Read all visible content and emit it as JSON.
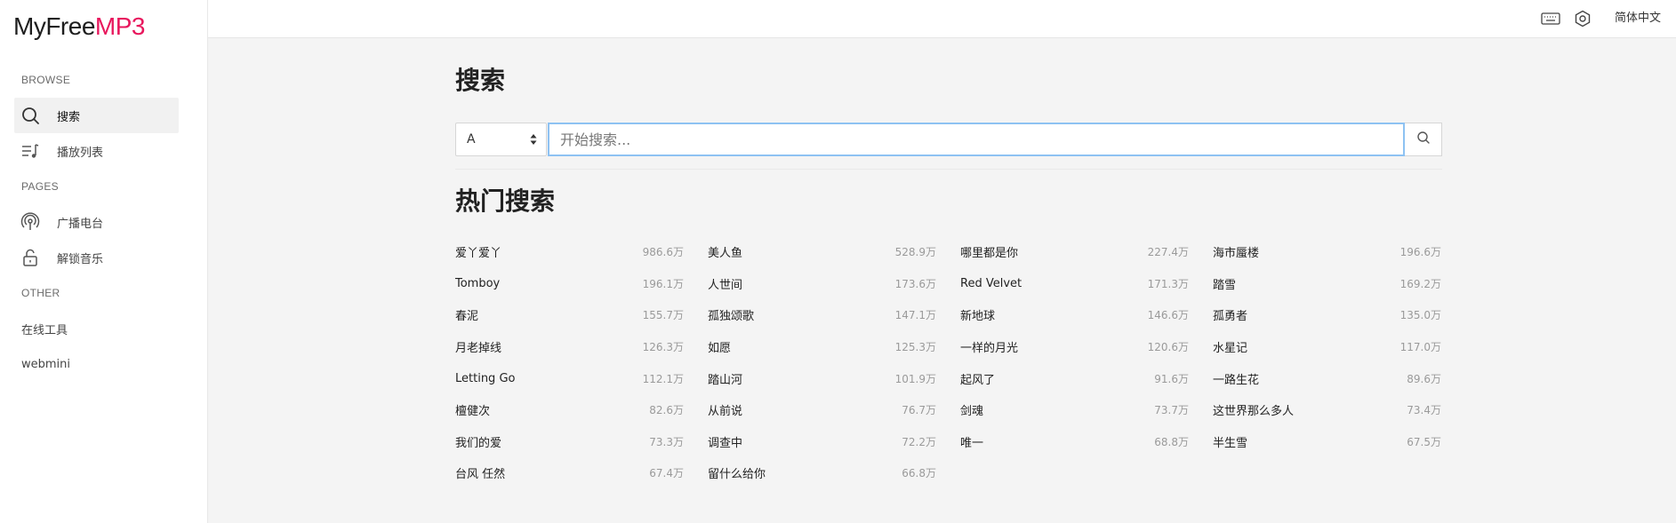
{
  "brand": {
    "part1": "MyFree",
    "part2": "MP3",
    "accent": "#e8175d"
  },
  "sidebar": {
    "sections": [
      {
        "label": "BROWSE"
      },
      {
        "label": "PAGES"
      },
      {
        "label": "OTHER"
      }
    ],
    "items": [
      {
        "label": "搜索",
        "icon": "search-icon",
        "active": true
      },
      {
        "label": "播放列表",
        "icon": "playlist-icon"
      },
      {
        "label": "广播电台",
        "icon": "radio-icon"
      },
      {
        "label": "解锁音乐",
        "icon": "unlock-icon"
      },
      {
        "label": "在线工具"
      },
      {
        "label": "webmini"
      }
    ]
  },
  "topbar": {
    "icons": [
      "keyboard-icon",
      "settings-icon"
    ],
    "language": "简体中文"
  },
  "main": {
    "title": "搜索",
    "search": {
      "source_selected": "A",
      "placeholder": "开始搜索...",
      "value": ""
    },
    "hot_title": "热门搜索",
    "hot_items": [
      {
        "name": "爱丫爱丫",
        "count": "986.6万"
      },
      {
        "name": "美人鱼",
        "count": "528.9万"
      },
      {
        "name": "哪里都是你",
        "count": "227.4万"
      },
      {
        "name": "海市蜃楼",
        "count": "196.6万"
      },
      {
        "name": "Tomboy",
        "count": "196.1万"
      },
      {
        "name": "人世间",
        "count": "173.6万"
      },
      {
        "name": "Red Velvet",
        "count": "171.3万"
      },
      {
        "name": "踏雪",
        "count": "169.2万"
      },
      {
        "name": "春泥",
        "count": "155.7万"
      },
      {
        "name": "孤独颂歌",
        "count": "147.1万"
      },
      {
        "name": "新地球",
        "count": "146.6万"
      },
      {
        "name": "孤勇者",
        "count": "135.0万"
      },
      {
        "name": "月老掉线",
        "count": "126.3万"
      },
      {
        "name": "如愿",
        "count": "125.3万"
      },
      {
        "name": "一样的月光",
        "count": "120.6万"
      },
      {
        "name": "水星记",
        "count": "117.0万"
      },
      {
        "name": "Letting Go",
        "count": "112.1万"
      },
      {
        "name": "踏山河",
        "count": "101.9万"
      },
      {
        "name": "起风了",
        "count": "91.6万"
      },
      {
        "name": "一路生花",
        "count": "89.6万"
      },
      {
        "name": "檀健次",
        "count": "82.6万"
      },
      {
        "name": "从前说",
        "count": "76.7万"
      },
      {
        "name": "剑魂",
        "count": "73.7万"
      },
      {
        "name": "这世界那么多人",
        "count": "73.4万"
      },
      {
        "name": "我们的爱",
        "count": "73.3万"
      },
      {
        "name": "调查中",
        "count": "72.2万"
      },
      {
        "name": "唯一",
        "count": "68.8万"
      },
      {
        "name": "半生雪",
        "count": "67.5万"
      },
      {
        "name": "台风 任然",
        "count": "67.4万"
      },
      {
        "name": "留什么给你",
        "count": "66.8万"
      }
    ]
  }
}
